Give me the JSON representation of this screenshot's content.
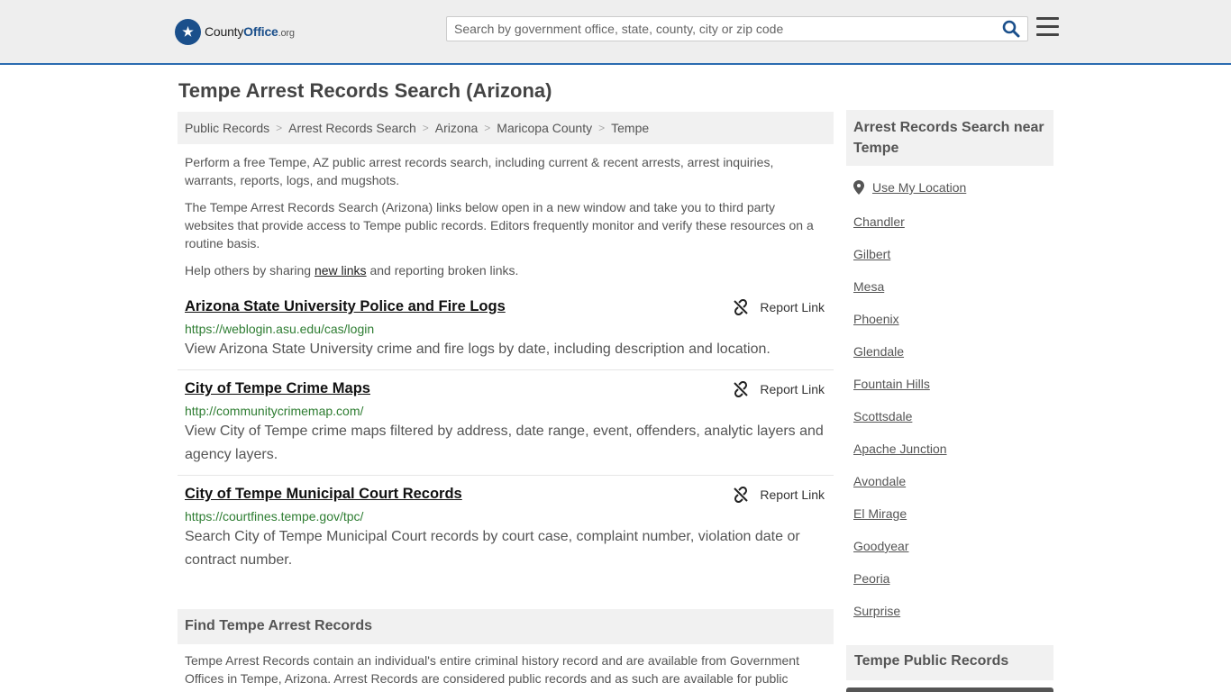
{
  "header": {
    "logo_prefix": "County",
    "logo_main": "Office",
    "logo_tld": ".org",
    "search_placeholder": "Search by government office, state, county, city or zip code"
  },
  "page_title": "Tempe Arrest Records Search (Arizona)",
  "breadcrumb": [
    "Public Records",
    "Arrest Records Search",
    "Arizona",
    "Maricopa County",
    "Tempe"
  ],
  "intro": {
    "p1": "Perform a free Tempe, AZ public arrest records search, including current & recent arrests, arrest inquiries, warrants, reports, logs, and mugshots.",
    "p2": "The Tempe Arrest Records Search (Arizona) links below open in a new window and take you to third party websites that provide access to Tempe public records. Editors frequently monitor and verify these resources on a routine basis.",
    "p3_before": "Help others by sharing ",
    "p3_link": "new links",
    "p3_after": " and reporting broken links."
  },
  "report_label": "Report Link",
  "results": [
    {
      "title": "Arizona State University Police and Fire Logs",
      "url": "https://weblogin.asu.edu/cas/login",
      "desc": "View Arizona State University crime and fire logs by date, including description and location."
    },
    {
      "title": "City of Tempe Crime Maps",
      "url": "http://communitycrimemap.com/",
      "desc": "View City of Tempe crime maps filtered by address, date range, event, offenders, analytic layers and agency layers."
    },
    {
      "title": "City of Tempe Municipal Court Records",
      "url": "https://courtfines.tempe.gov/tpc/",
      "desc": "Search City of Tempe Municipal Court records by court case, complaint number, violation date or contract number."
    }
  ],
  "find": {
    "heading": "Find Tempe Arrest Records",
    "text": "Tempe Arrest Records contain an individual's entire criminal history record and are available from Government Offices in Tempe, Arizona. Arrest Records are considered public records and as such are available for public"
  },
  "sidebar": {
    "heading": "Arrest Records Search near Tempe",
    "use_location": "Use My Location",
    "cities": [
      "Chandler",
      "Gilbert",
      "Mesa",
      "Phoenix",
      "Glendale",
      "Fountain Hills",
      "Scottsdale",
      "Apache Junction",
      "Avondale",
      "El Mirage",
      "Goodyear",
      "Peoria",
      "Surprise"
    ],
    "heading2": "Tempe Public Records"
  },
  "colors": {
    "header_bg": "#eeeeee",
    "header_border": "#2b6cb0",
    "url_green": "#2e7d32",
    "panel_bg": "#f1f1f1"
  }
}
